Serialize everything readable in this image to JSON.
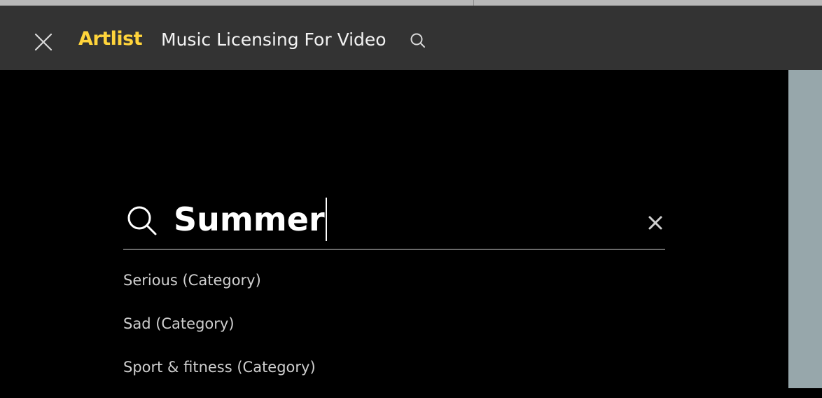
{
  "header": {
    "logo": "Artlist",
    "title": "Music Licensing For Video",
    "close_icon": "close-icon",
    "search_icon": "search-icon"
  },
  "search": {
    "value": "Summer",
    "icon": "search-icon",
    "clear_icon": "close-icon"
  },
  "suggestions": [
    "Serious (Category)",
    "Sad (Category)",
    "Sport & fitness (Category)"
  ],
  "colors": {
    "header_bg": "#333333",
    "brand": "#ffd43b",
    "main_bg": "#000000",
    "side_panel": "#97a7ab",
    "text": "#ffffff",
    "suggestion_text": "#cfcfcf"
  }
}
